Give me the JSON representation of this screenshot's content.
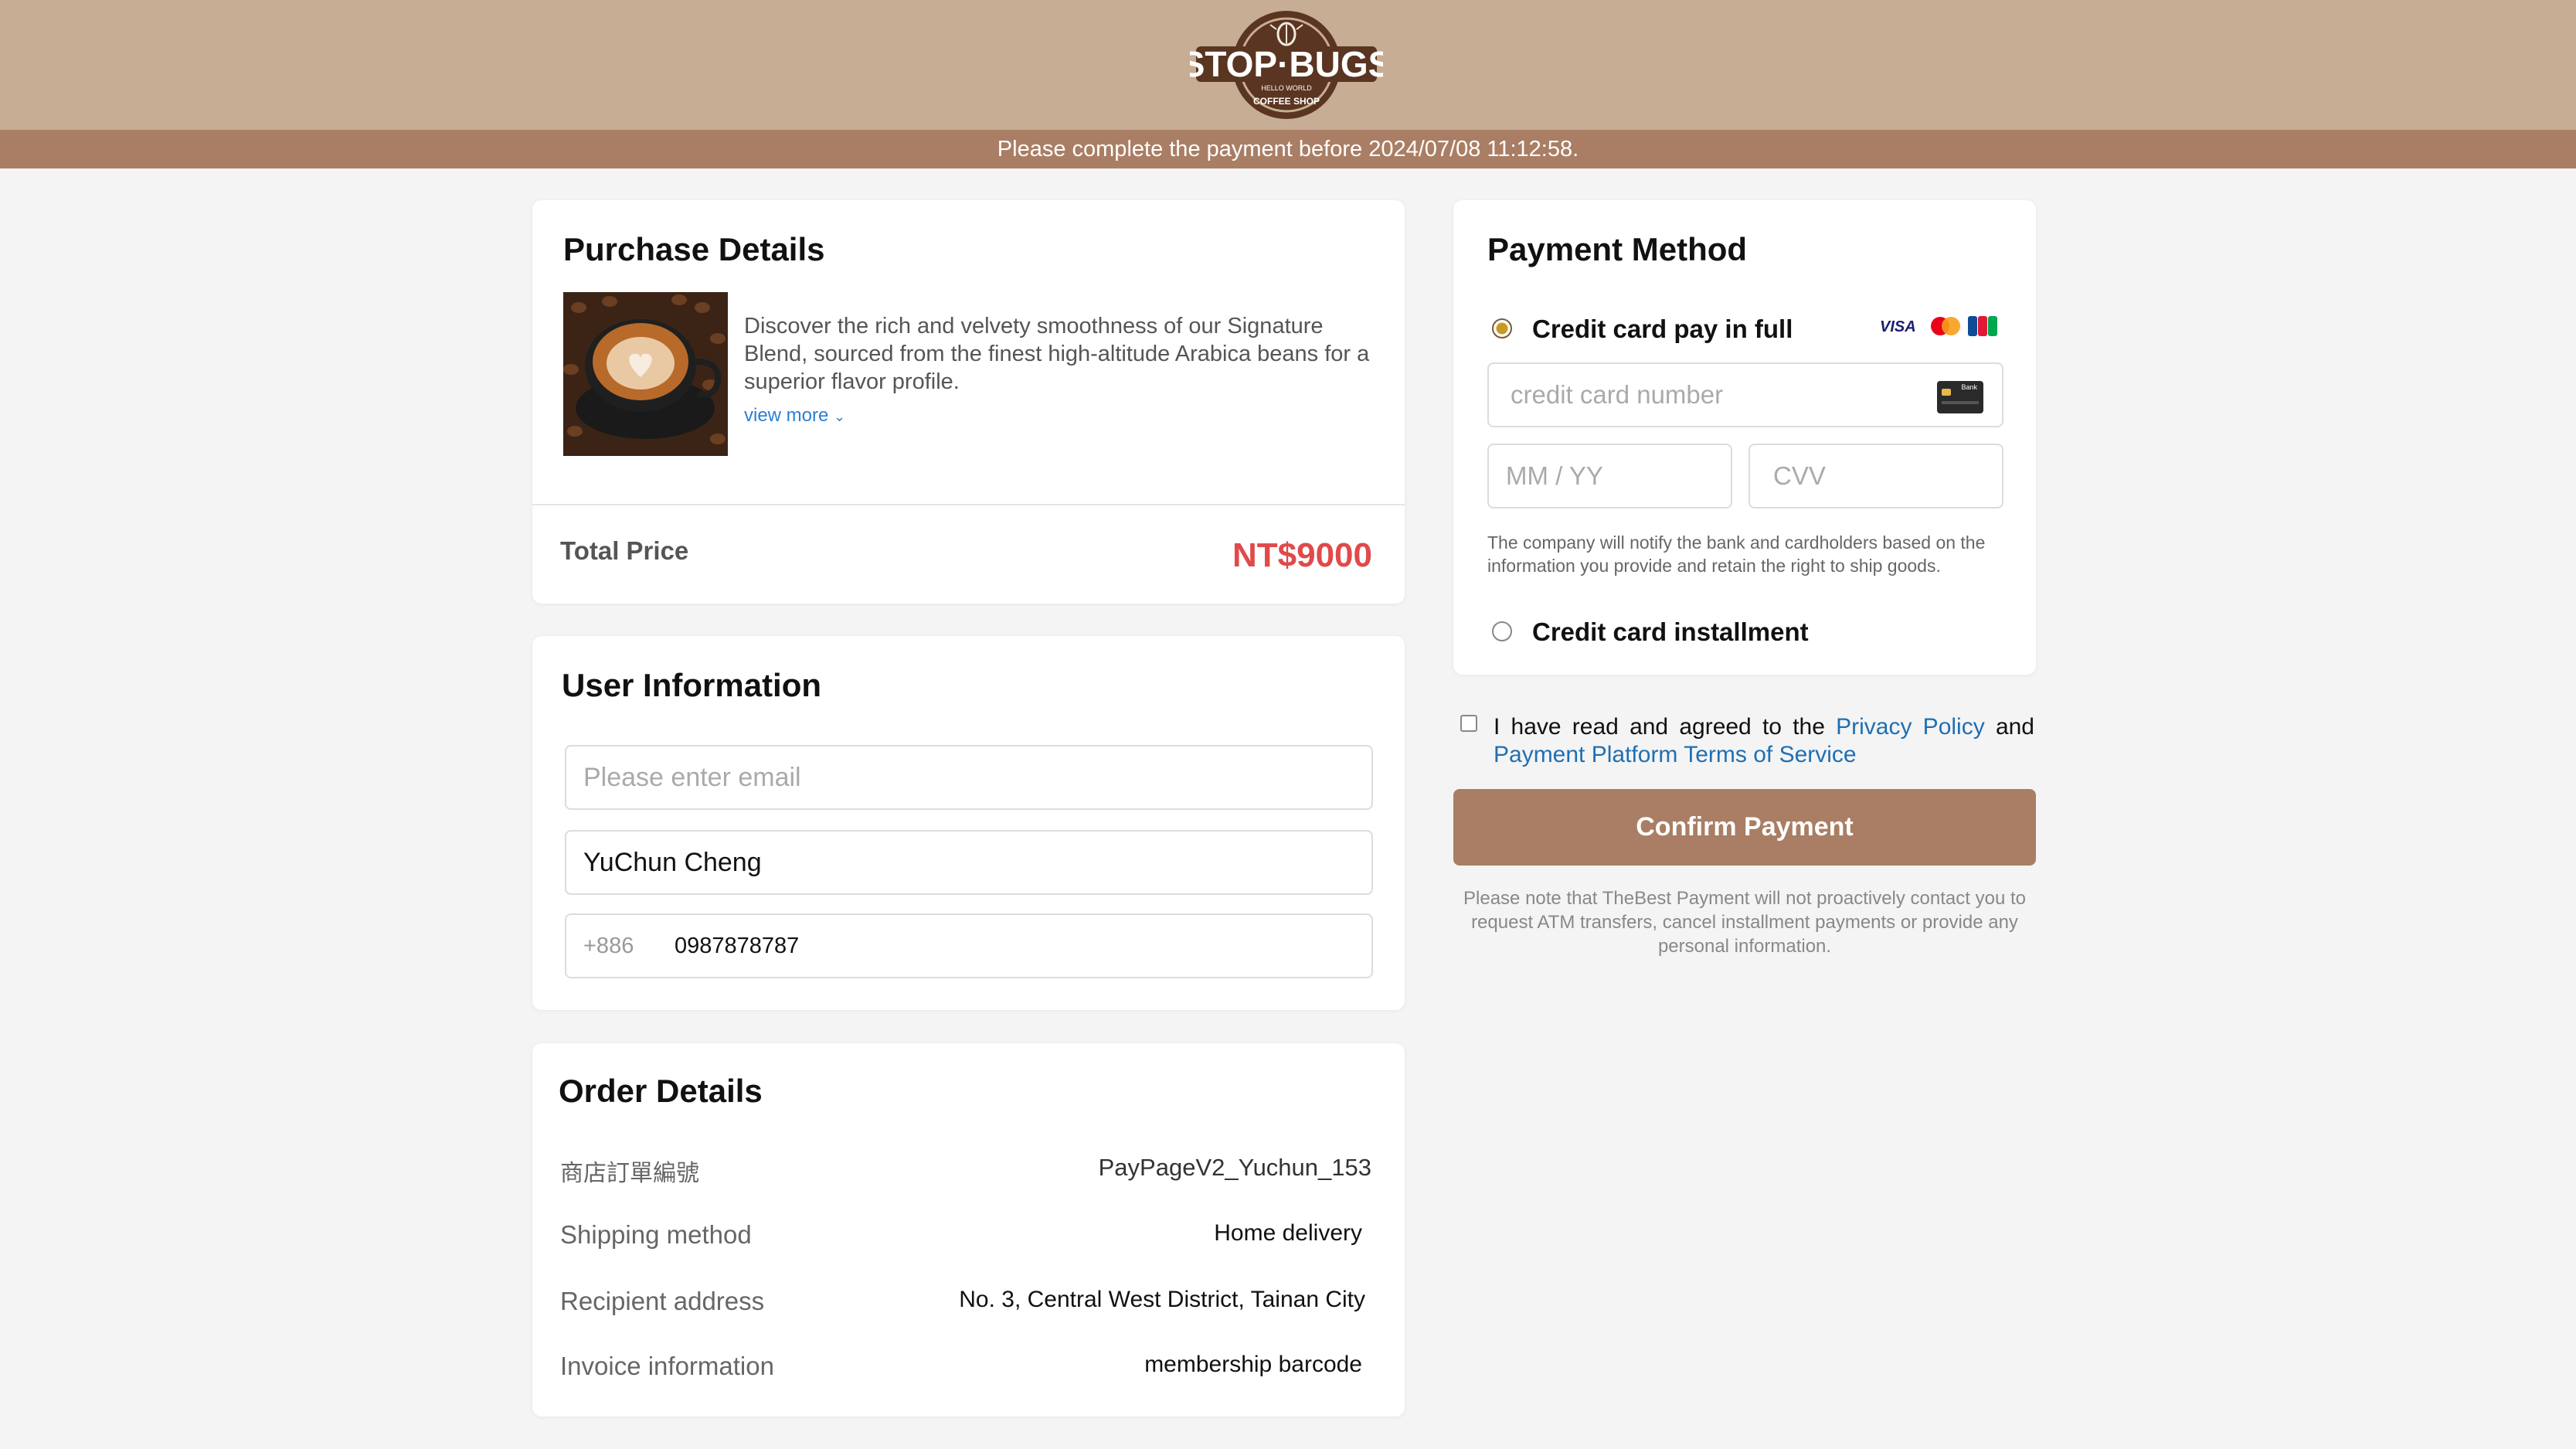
{
  "header": {
    "logo_text": "STOP·BUGS",
    "logo_subtext": "HELLO WORLD",
    "logo_ring_text": "COFFEE SHOP",
    "notice": "Please complete the payment before 2024/07/08 11:12:58."
  },
  "purchase": {
    "title": "Purchase Details",
    "description": "Discover the rich and velvety smoothness of our Signature Blend, sourced from the finest high-altitude Arabica beans for a superior flavor profile.",
    "view_more": "view more",
    "total_label": "Total Price",
    "total_value": "NT$9000"
  },
  "user": {
    "title": "User Information",
    "email_placeholder": "Please enter email",
    "email_value": "",
    "name_value": "YuChun Cheng",
    "country_code": "+886",
    "phone_value": "0987878787"
  },
  "order": {
    "title": "Order Details",
    "rows": [
      {
        "label": "商店訂單編號",
        "value": "PayPageV2_Yuchun_153"
      },
      {
        "label": "Shipping method",
        "value": "Home delivery"
      },
      {
        "label": "Recipient address",
        "value": "No. 3, Central West District, Tainan City"
      },
      {
        "label": "Invoice information",
        "value": "membership barcode"
      }
    ]
  },
  "payment": {
    "title": "Payment Method",
    "option_full": "Credit card pay in full",
    "option_installment": "Credit card installment",
    "card_placeholder": "credit card number",
    "expiry_placeholder": "MM / YY",
    "cvv_placeholder": "CVV",
    "card_icon_text": "Bank",
    "brands": [
      "VISA",
      "mastercard",
      "JCB"
    ],
    "note": "The company will notify the bank and cardholders based on the information you provide and retain the right to ship goods."
  },
  "agreement": {
    "prefix": "I have read and agreed to the",
    "privacy_link": "Privacy Policy",
    "and": "and",
    "terms_link": "Payment Platform Terms of Service"
  },
  "confirm_label": "Confirm Payment",
  "disclaimer": "Please note that TheBest Payment will not proactively contact you to request ATM transfers, cancel installment payments or provide any personal information.",
  "colors": {
    "header_bg": "#c7ad93",
    "notice_bg": "#a97e64",
    "accent": "#a97e64",
    "price": "#e04a4a",
    "link": "#1f6fb3"
  }
}
